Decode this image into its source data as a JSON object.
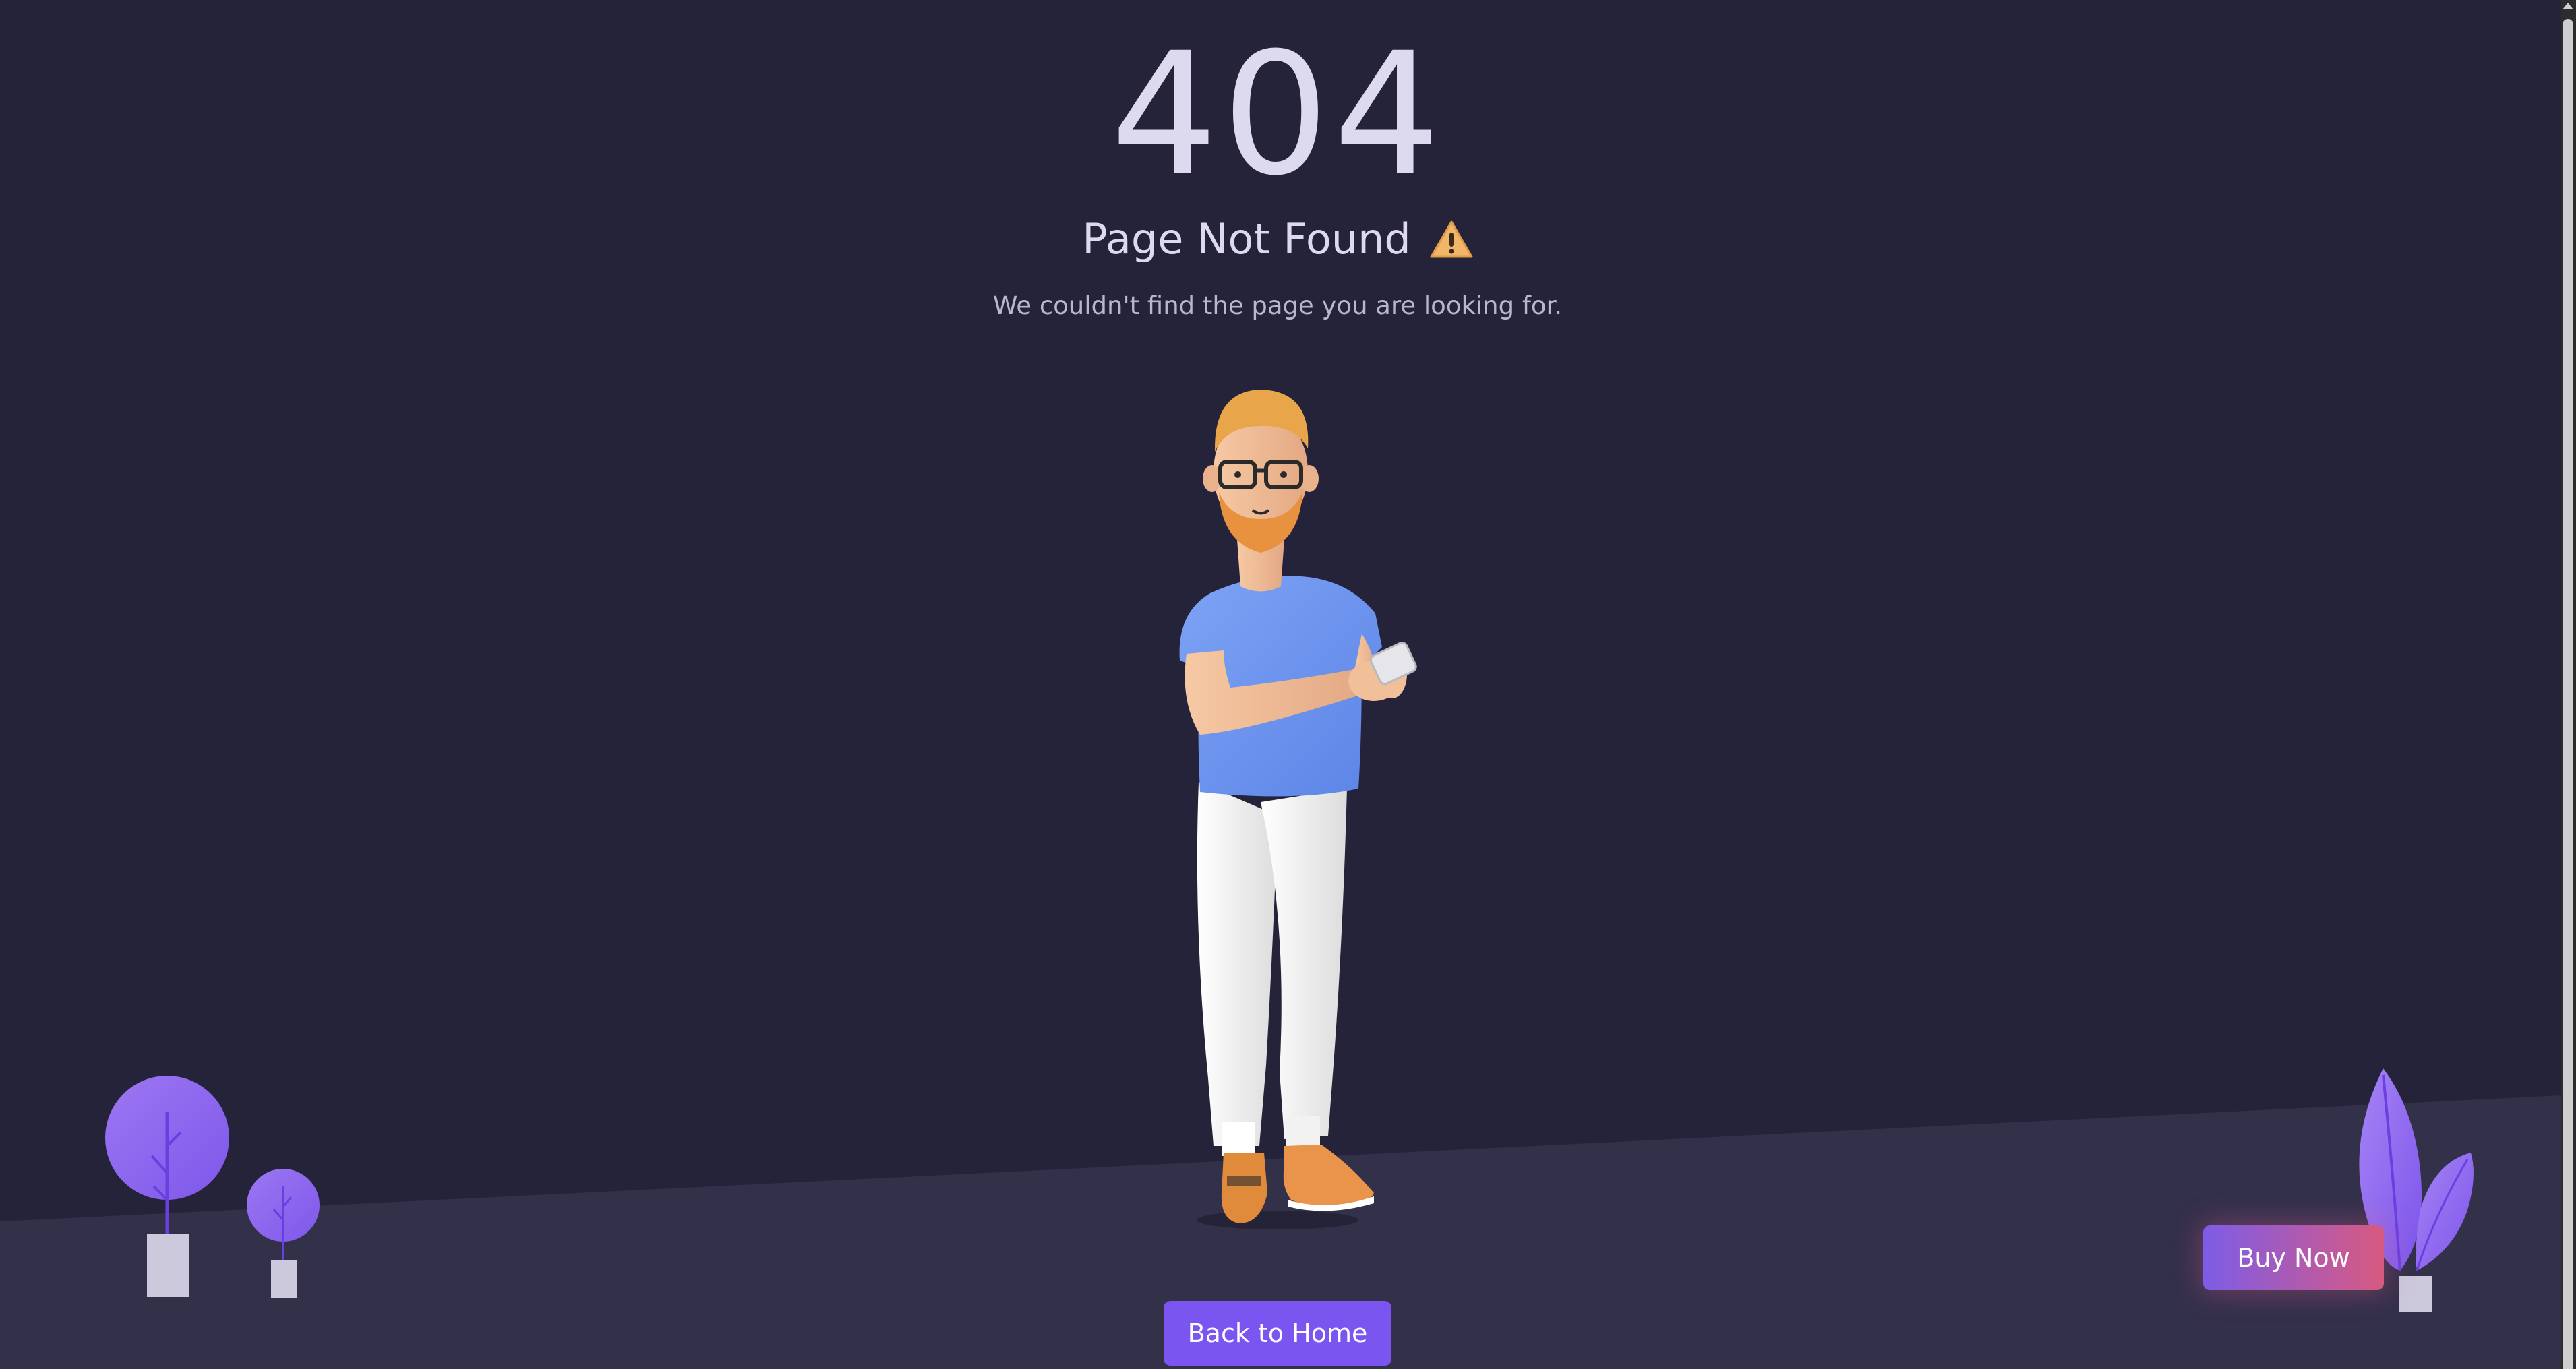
{
  "error": {
    "code": "404",
    "title": "Page Not Found",
    "message": "We couldn't find the page you are looking for."
  },
  "actions": {
    "home_label": "Back to Home",
    "buy_label": "Buy Now"
  },
  "icons": {
    "warning": "warning-icon"
  },
  "colors": {
    "background": "#25233a",
    "floor": "#33304a",
    "accent": "#7a55ef",
    "text": "#dddaf0"
  }
}
